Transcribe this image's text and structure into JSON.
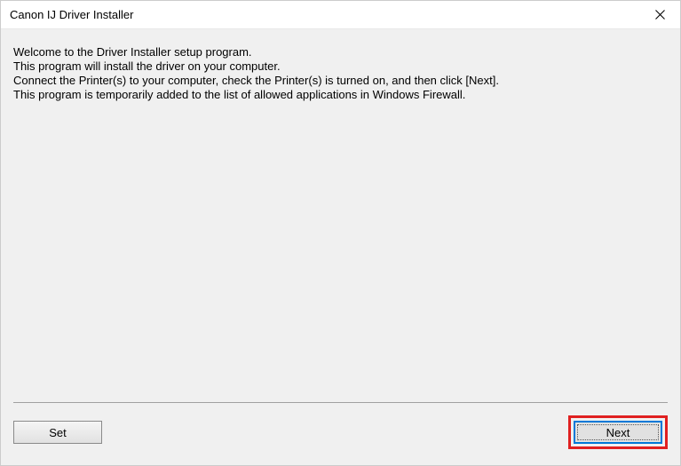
{
  "titlebar": {
    "title": "Canon IJ Driver Installer"
  },
  "content": {
    "line1": "Welcome to the Driver Installer setup program.",
    "line2": "This program will install the driver on your computer.",
    "line3": "Connect the Printer(s) to your computer, check the Printer(s) is turned on, and then click [Next].",
    "line4": "This program is temporarily added to the list of allowed applications in Windows Firewall."
  },
  "buttons": {
    "set": "Set",
    "next": "Next"
  }
}
